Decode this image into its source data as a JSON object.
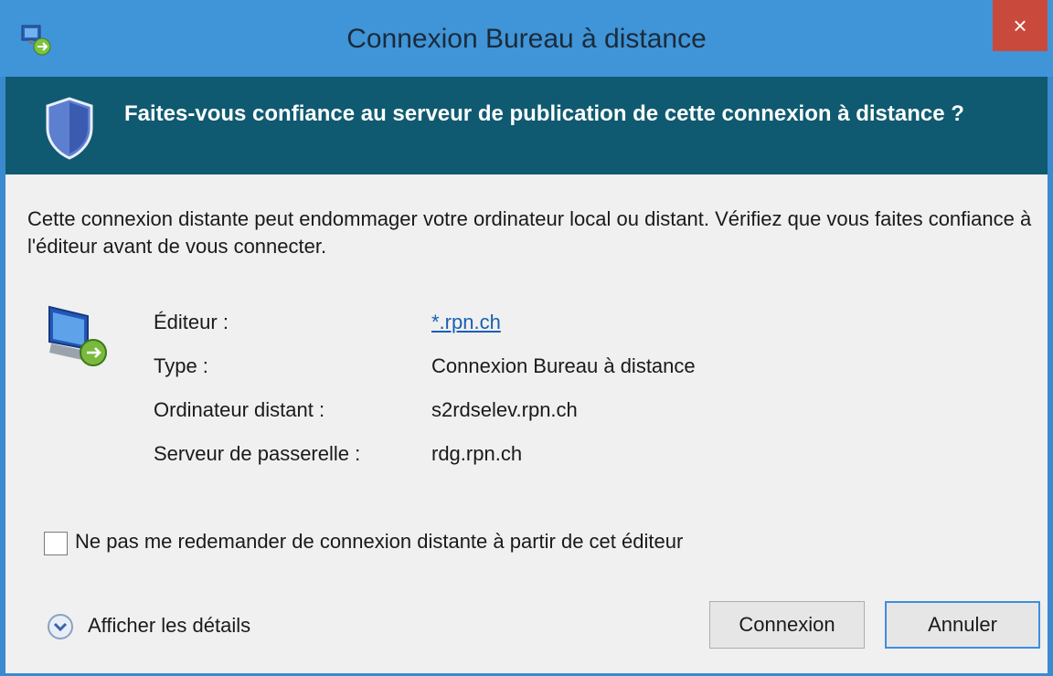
{
  "window": {
    "title": "Connexion Bureau à distance",
    "close_glyph": "×"
  },
  "banner": {
    "title": "Faites-vous confiance au serveur de publication de cette connexion à distance ?"
  },
  "warning_text": "Cette connexion distante peut endommager votre ordinateur local ou distant. Vérifiez que vous faites confiance à l'éditeur avant de vous connecter.",
  "details": {
    "publisher_label": "Éditeur :",
    "publisher_value": "*.rpn.ch",
    "type_label": "Type :",
    "type_value": "Connexion Bureau à distance",
    "remote_label": "Ordinateur distant :",
    "remote_value": "s2rdselev.rpn.ch",
    "gateway_label": "Serveur de passerelle :",
    "gateway_value": "rdg.rpn.ch"
  },
  "checkbox": {
    "label": "Ne pas me redemander de connexion distante à partir de cet éditeur",
    "checked": false
  },
  "footer": {
    "show_details_label": "Afficher les détails",
    "connect_label": "Connexion",
    "cancel_label": "Annuler"
  },
  "colors": {
    "titlebar": "#3f95d8",
    "banner": "#0f5a70",
    "close": "#c94a3c",
    "link": "#1a5fb4"
  }
}
